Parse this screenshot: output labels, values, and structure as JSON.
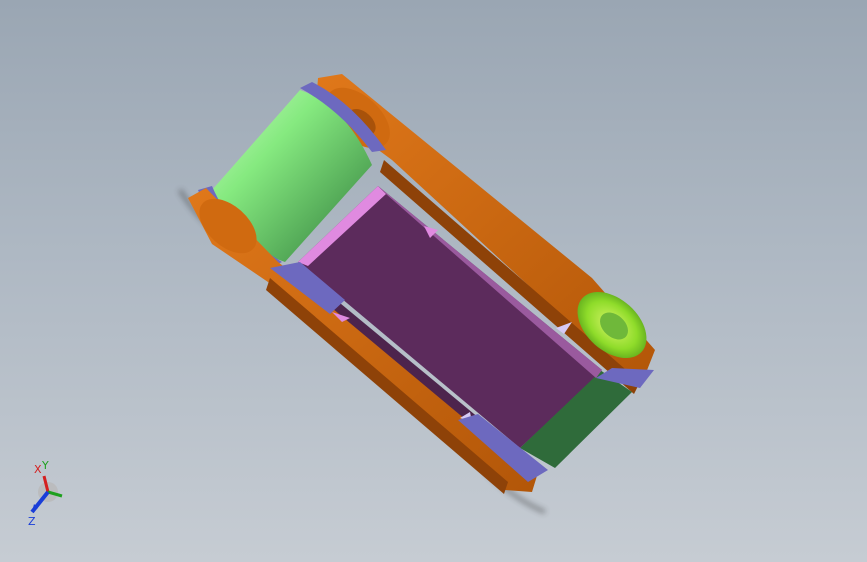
{
  "viewport": {
    "background_top": "#9aa6b3",
    "background_bottom": "#c6ccd3"
  },
  "model": {
    "parts": [
      {
        "name": "side-plate",
        "color": "#c8620d"
      },
      {
        "name": "side-plate-edge",
        "color": "#8e4208"
      },
      {
        "name": "washer",
        "color": "#7d79c8"
      },
      {
        "name": "pin-cylinder",
        "color": "#7ee87c"
      },
      {
        "name": "pin-cylinder-shadow",
        "color": "#2f6b3a"
      },
      {
        "name": "center-body",
        "color": "#5c2b5c"
      },
      {
        "name": "center-body-highlight",
        "color": "#e08ae0"
      },
      {
        "name": "center-body-side",
        "color": "#9a5a9e"
      },
      {
        "name": "pin-end",
        "color": "#8fdc2a"
      }
    ]
  },
  "triad": {
    "x_label": "X",
    "y_label": "Y",
    "z_label": "Z",
    "x_color": "#d42020",
    "y_color": "#1ea01e",
    "z_color": "#1a3ed8"
  }
}
